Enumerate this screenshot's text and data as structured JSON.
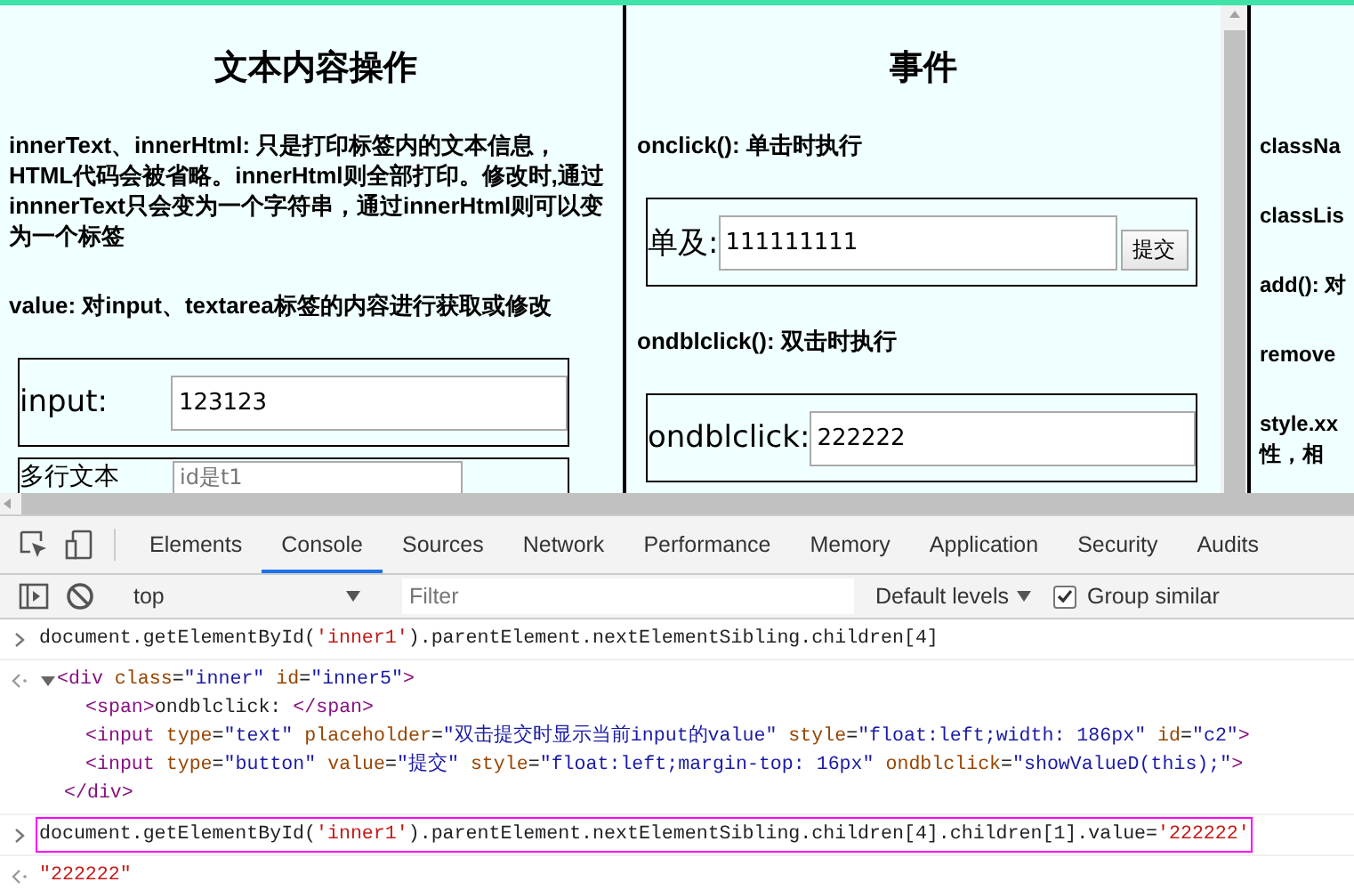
{
  "page": {
    "columns": [
      {
        "title": "文本内容操作",
        "items": [
          {
            "kind": "note",
            "text": "innerText、innerHtml: 只是打印标签内的文本信息，HTML代码会被省略。innerHtml则全部打印。修改时,通过innnerText只会变为一个字符串，通过innerHtml则可以变为一个标签"
          },
          {
            "kind": "note",
            "text": "value: 对input、textarea标签的内容进行获取或修改"
          },
          {
            "kind": "input-row",
            "label": "input:",
            "value": "123123"
          },
          {
            "kind": "textarea-row",
            "label": "多行文本",
            "placeholder": "id是t1"
          }
        ]
      },
      {
        "title": "事件",
        "items": [
          {
            "kind": "note",
            "text": "onclick(): 单击时执行"
          },
          {
            "kind": "input-row",
            "label": "单及:",
            "value": "111111111",
            "button": "提交"
          },
          {
            "kind": "note",
            "text": "ondblclick(): 双击时执行"
          },
          {
            "kind": "input-row",
            "label": "ondblclick:",
            "value": "222222"
          }
        ]
      },
      {
        "items": [
          {
            "kind": "note",
            "text": "classNa"
          },
          {
            "kind": "note",
            "text": "classLis"
          },
          {
            "kind": "note",
            "text": "add(): 对"
          },
          {
            "kind": "note",
            "text": "remove"
          },
          {
            "kind": "note",
            "text": "style.xx"
          },
          {
            "kind": "continuation",
            "text": "性，相"
          }
        ]
      }
    ]
  },
  "devtools": {
    "tabs": [
      {
        "label": "Elements",
        "selected": false
      },
      {
        "label": "Console",
        "selected": true
      },
      {
        "label": "Sources",
        "selected": false
      },
      {
        "label": "Network",
        "selected": false
      },
      {
        "label": "Performance",
        "selected": false
      },
      {
        "label": "Memory",
        "selected": false
      },
      {
        "label": "Application",
        "selected": false
      },
      {
        "label": "Security",
        "selected": false
      },
      {
        "label": "Audits",
        "selected": false
      }
    ],
    "toolbar": {
      "context": "top",
      "filter_placeholder": "Filter",
      "levels": "Default levels",
      "group_similar": {
        "label": "Group similar",
        "checked": true
      }
    },
    "console": [
      {
        "kind": "input",
        "highlighted": false,
        "tokens": [
          {
            "kind": "code",
            "text": "document.getElementById("
          },
          {
            "kind": "string",
            "text": "'inner1'"
          },
          {
            "kind": "code",
            "text": ").parentElement.nextElementSibling.children[4]"
          }
        ]
      },
      {
        "kind": "element",
        "expanded": true,
        "open": [
          {
            "kind": "tag",
            "text": "<div"
          },
          {
            "kind": "attr",
            "text": " class"
          },
          {
            "kind": "code",
            "text": "="
          },
          {
            "kind": "value",
            "text": "\"inner\""
          },
          {
            "kind": "attr",
            "text": " id"
          },
          {
            "kind": "code",
            "text": "="
          },
          {
            "kind": "value",
            "text": "\"inner5\""
          },
          {
            "kind": "tag",
            "text": ">"
          }
        ],
        "children": [
          [
            {
              "kind": "tag",
              "text": "<span>"
            },
            {
              "kind": "code",
              "text": "ondblclick: "
            },
            {
              "kind": "tag",
              "text": "</span>"
            }
          ],
          [
            {
              "kind": "tag",
              "text": "<input"
            },
            {
              "kind": "attr",
              "text": " type"
            },
            {
              "kind": "code",
              "text": "="
            },
            {
              "kind": "value",
              "text": "\"text\""
            },
            {
              "kind": "attr",
              "text": " placeholder"
            },
            {
              "kind": "code",
              "text": "="
            },
            {
              "kind": "value",
              "text": "\"双击提交时显示当前input的value\""
            },
            {
              "kind": "attr",
              "text": " style"
            },
            {
              "kind": "code",
              "text": "="
            },
            {
              "kind": "value",
              "text": "\"float:left;width: 186px\""
            },
            {
              "kind": "attr",
              "text": " id"
            },
            {
              "kind": "code",
              "text": "="
            },
            {
              "kind": "value",
              "text": "\"c2\""
            },
            {
              "kind": "tag",
              "text": ">"
            }
          ],
          [
            {
              "kind": "tag",
              "text": "<input"
            },
            {
              "kind": "attr",
              "text": " type"
            },
            {
              "kind": "code",
              "text": "="
            },
            {
              "kind": "value",
              "text": "\"button\""
            },
            {
              "kind": "attr",
              "text": " value"
            },
            {
              "kind": "code",
              "text": "="
            },
            {
              "kind": "value",
              "text": "\"提交\""
            },
            {
              "kind": "attr",
              "text": " style"
            },
            {
              "kind": "code",
              "text": "="
            },
            {
              "kind": "value",
              "text": "\"float:left;margin-top: 16px\""
            },
            {
              "kind": "attr",
              "text": " ondblclick"
            },
            {
              "kind": "code",
              "text": "="
            },
            {
              "kind": "value",
              "text": "\"showValueD(this);\""
            },
            {
              "kind": "tag",
              "text": ">"
            }
          ]
        ],
        "close": [
          {
            "kind": "tag",
            "text": "</div>"
          }
        ]
      },
      {
        "kind": "input",
        "highlighted": true,
        "tokens": [
          {
            "kind": "code",
            "text": "document.getElementById("
          },
          {
            "kind": "string",
            "text": "'inner1'"
          },
          {
            "kind": "code",
            "text": ").parentElement.nextElementSibling.children[4].children[1].value="
          },
          {
            "kind": "string",
            "text": "'222222'"
          }
        ]
      },
      {
        "kind": "result",
        "highlighted": false,
        "tokens": [
          {
            "kind": "string",
            "text": "\"222222\""
          }
        ]
      }
    ]
  }
}
